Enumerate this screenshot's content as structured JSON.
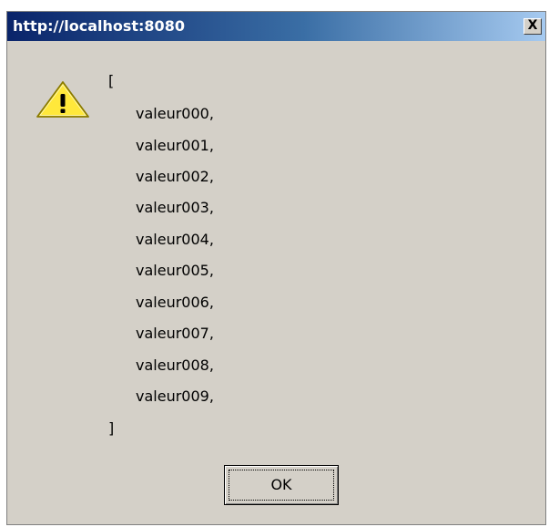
{
  "dialog": {
    "title": "http://localhost:8080",
    "close_label": "X",
    "icon": "warning-icon",
    "message": {
      "open": "[",
      "values": [
        "valeur000,",
        "valeur001,",
        "valeur002,",
        "valeur003,",
        "valeur004,",
        "valeur005,",
        "valeur006,",
        "valeur007,",
        "valeur008,",
        "valeur009,"
      ],
      "close": "]"
    },
    "ok_label": "OK"
  },
  "colors": {
    "dialog_bg": "#d4d0c8",
    "titlebar_start": "#0a246a",
    "titlebar_end": "#a6caf0",
    "warning_fill": "#ffe83b"
  }
}
